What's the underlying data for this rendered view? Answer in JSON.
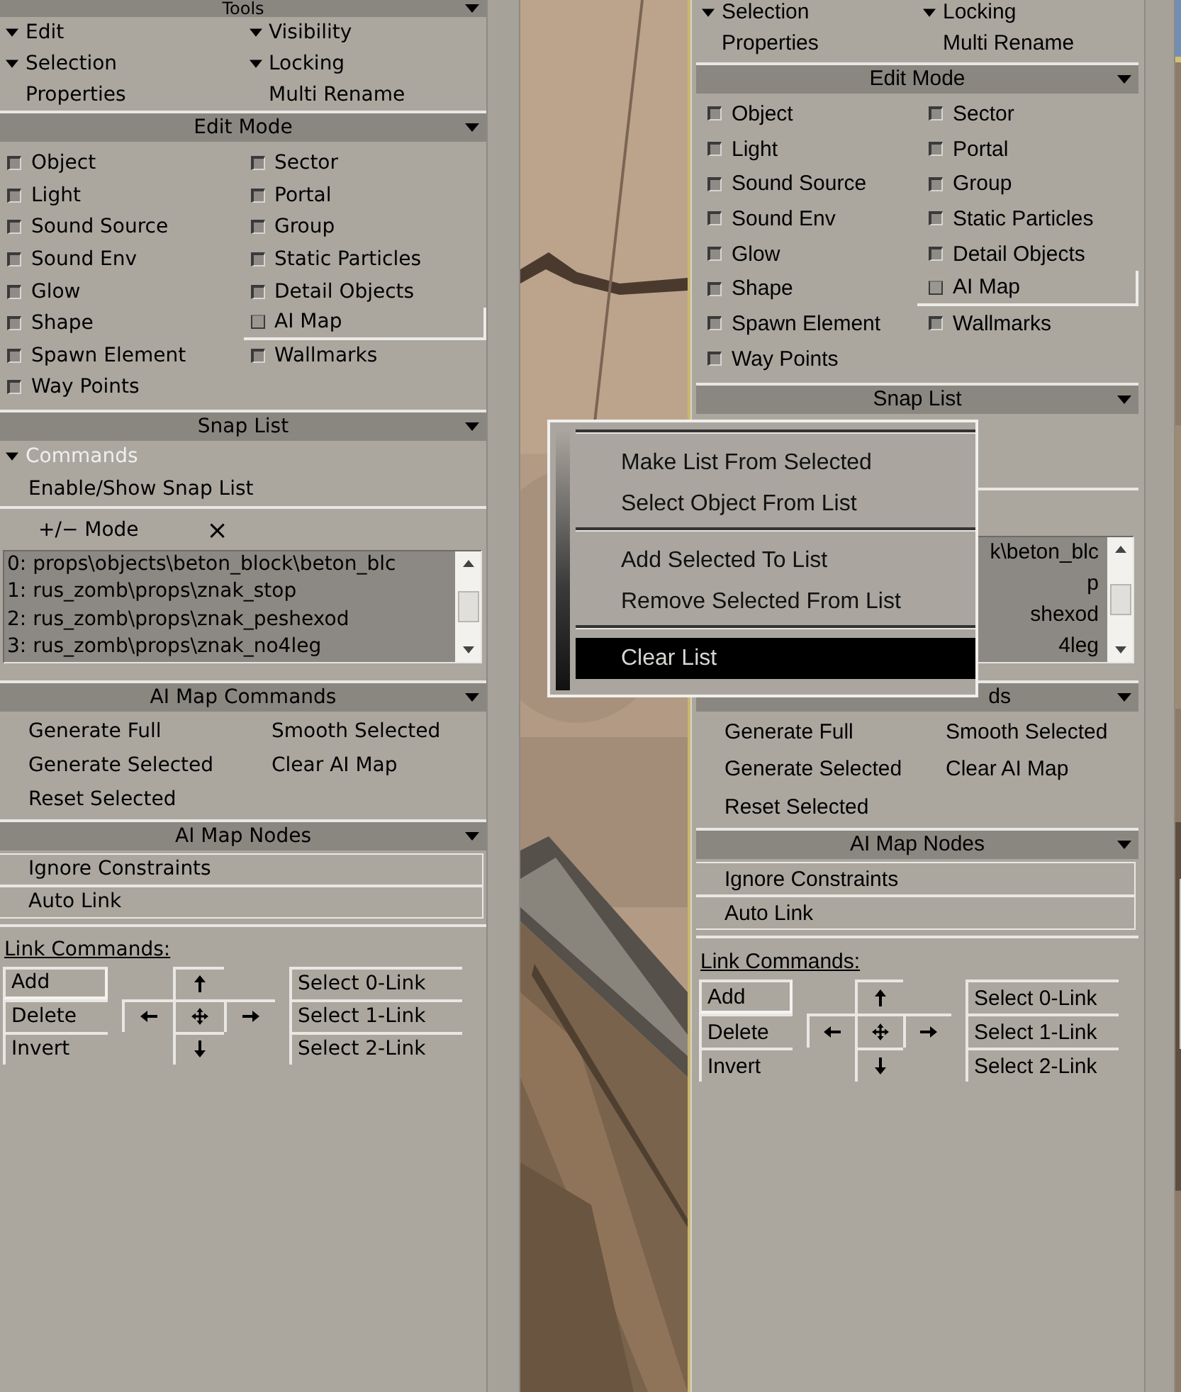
{
  "panels": [
    {
      "tools": {
        "title": "Tools",
        "items": [
          {
            "kind": "group",
            "label": "Edit"
          },
          {
            "kind": "group",
            "label": "Visibility"
          },
          {
            "kind": "group",
            "label": "Selection"
          },
          {
            "kind": "group",
            "label": "Locking"
          },
          {
            "kind": "command",
            "label": "Properties"
          },
          {
            "kind": "command",
            "label": "Multi Rename"
          }
        ]
      },
      "edit_mode": {
        "title": "Edit Mode",
        "items": [
          {
            "label": "Object",
            "checked": false,
            "highlighted": false
          },
          {
            "label": "Sector",
            "checked": false,
            "highlighted": false
          },
          {
            "label": "Light",
            "checked": false,
            "highlighted": false
          },
          {
            "label": "Portal",
            "checked": false,
            "highlighted": false
          },
          {
            "label": "Sound Source",
            "checked": false,
            "highlighted": false
          },
          {
            "label": "Group",
            "checked": false,
            "highlighted": false
          },
          {
            "label": "Sound Env",
            "checked": false,
            "highlighted": false
          },
          {
            "label": "Static Particles",
            "checked": false,
            "highlighted": false
          },
          {
            "label": "Glow",
            "checked": false,
            "highlighted": false
          },
          {
            "label": "Detail Objects",
            "checked": false,
            "highlighted": false
          },
          {
            "label": "Shape",
            "checked": false,
            "highlighted": false
          },
          {
            "label": "AI Map",
            "checked": false,
            "highlighted": true
          },
          {
            "label": "Spawn Element",
            "checked": false,
            "highlighted": false
          },
          {
            "label": "Wallmarks",
            "checked": false,
            "highlighted": false
          },
          {
            "label": "Way Points",
            "checked": false,
            "highlighted": false
          }
        ]
      },
      "snap_list": {
        "title": "Snap List",
        "commands": [
          {
            "kind": "group",
            "label": "Commands",
            "highlighted": true
          },
          {
            "kind": "command",
            "label": "Enable/Show Snap List",
            "highlighted": false
          }
        ],
        "mode": {
          "label": "+/− Mode",
          "remove": "×"
        },
        "list": [
          "0: props\\objects\\beton_block\\beton_blc",
          "1: rus_zomb\\props\\znak_stop",
          "2: rus_zomb\\props\\znak_peshexod",
          "3: rus_zomb\\props\\znak_no4leg"
        ]
      },
      "ai_map_commands": {
        "title": "AI Map Commands",
        "buttons": [
          "Generate Full",
          "Smooth Selected",
          "Generate Selected",
          "Clear AI Map",
          "Reset Selected"
        ]
      },
      "ai_map_nodes": {
        "title": "AI Map Nodes",
        "options": [
          "Ignore Constraints",
          "Auto Link"
        ]
      },
      "link_commands": {
        "label": "Link Commands:",
        "left": [
          "Add",
          "Delete",
          "Invert"
        ],
        "right": [
          "Select 0-Link",
          "Select 1-Link",
          "Select 2-Link"
        ]
      }
    },
    {
      "tools": {
        "items": [
          {
            "kind": "group",
            "label": "Selection"
          },
          {
            "kind": "group",
            "label": "Locking"
          },
          {
            "kind": "command",
            "label": "Properties"
          },
          {
            "kind": "command",
            "label": "Multi Rename"
          }
        ]
      },
      "edit_mode": {
        "title": "Edit Mode",
        "items": [
          {
            "label": "Object",
            "checked": false,
            "highlighted": false
          },
          {
            "label": "Sector",
            "checked": false,
            "highlighted": false
          },
          {
            "label": "Light",
            "checked": false,
            "highlighted": false
          },
          {
            "label": "Portal",
            "checked": false,
            "highlighted": false
          },
          {
            "label": "Sound Source",
            "checked": false,
            "highlighted": false
          },
          {
            "label": "Group",
            "checked": false,
            "highlighted": false
          },
          {
            "label": "Sound Env",
            "checked": false,
            "highlighted": false
          },
          {
            "label": "Static Particles",
            "checked": false,
            "highlighted": false
          },
          {
            "label": "Glow",
            "checked": false,
            "highlighted": false
          },
          {
            "label": "Detail Objects",
            "checked": false,
            "highlighted": false
          },
          {
            "label": "Shape",
            "checked": false,
            "highlighted": false
          },
          {
            "label": "AI Map",
            "checked": false,
            "highlighted": true
          },
          {
            "label": "Spawn Element",
            "checked": false,
            "highlighted": false
          },
          {
            "label": "Wallmarks",
            "checked": false,
            "highlighted": false
          },
          {
            "label": "Way Points",
            "checked": false,
            "highlighted": false
          }
        ]
      },
      "snap_list": {
        "title": "Snap List",
        "list": [
          "k\\beton_blc",
          "p",
          "shexod",
          "4leg"
        ]
      },
      "ai_map_commands": {
        "title": "ds",
        "buttons": [
          "Generate Full",
          "Smooth Selected",
          "Generate Selected",
          "Clear AI Map",
          "Reset Selected"
        ]
      },
      "ai_map_nodes": {
        "title": "AI Map Nodes",
        "options": [
          "Ignore Constraints",
          "Auto Link"
        ]
      },
      "link_commands": {
        "label": "Link Commands:",
        "left": [
          "Add",
          "Delete",
          "Invert"
        ],
        "right": [
          "Select 0-Link",
          "Select 1-Link",
          "Select 2-Link"
        ]
      }
    }
  ],
  "context_menu": {
    "items": [
      {
        "kind": "separator"
      },
      {
        "kind": "item",
        "label": "Make List From Selected",
        "selected": false
      },
      {
        "kind": "item",
        "label": "Select Object From List",
        "selected": false
      },
      {
        "kind": "separator"
      },
      {
        "kind": "item",
        "label": "Add Selected To List",
        "selected": false
      },
      {
        "kind": "item",
        "label": "Remove Selected From List",
        "selected": false
      },
      {
        "kind": "separator"
      },
      {
        "kind": "item",
        "label": "Clear List",
        "selected": true
      }
    ]
  }
}
